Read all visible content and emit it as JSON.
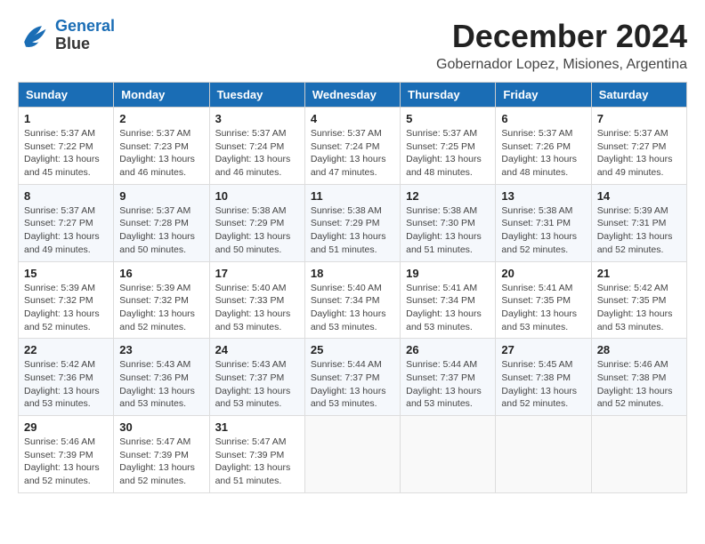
{
  "logo": {
    "line1": "General",
    "line2": "Blue"
  },
  "title": "December 2024",
  "subtitle": "Gobernador Lopez, Misiones, Argentina",
  "days_of_week": [
    "Sunday",
    "Monday",
    "Tuesday",
    "Wednesday",
    "Thursday",
    "Friday",
    "Saturday"
  ],
  "weeks": [
    [
      {
        "day": "1",
        "info": "Sunrise: 5:37 AM\nSunset: 7:22 PM\nDaylight: 13 hours\nand 45 minutes."
      },
      {
        "day": "2",
        "info": "Sunrise: 5:37 AM\nSunset: 7:23 PM\nDaylight: 13 hours\nand 46 minutes."
      },
      {
        "day": "3",
        "info": "Sunrise: 5:37 AM\nSunset: 7:24 PM\nDaylight: 13 hours\nand 46 minutes."
      },
      {
        "day": "4",
        "info": "Sunrise: 5:37 AM\nSunset: 7:24 PM\nDaylight: 13 hours\nand 47 minutes."
      },
      {
        "day": "5",
        "info": "Sunrise: 5:37 AM\nSunset: 7:25 PM\nDaylight: 13 hours\nand 48 minutes."
      },
      {
        "day": "6",
        "info": "Sunrise: 5:37 AM\nSunset: 7:26 PM\nDaylight: 13 hours\nand 48 minutes."
      },
      {
        "day": "7",
        "info": "Sunrise: 5:37 AM\nSunset: 7:27 PM\nDaylight: 13 hours\nand 49 minutes."
      }
    ],
    [
      {
        "day": "8",
        "info": "Sunrise: 5:37 AM\nSunset: 7:27 PM\nDaylight: 13 hours\nand 49 minutes."
      },
      {
        "day": "9",
        "info": "Sunrise: 5:37 AM\nSunset: 7:28 PM\nDaylight: 13 hours\nand 50 minutes."
      },
      {
        "day": "10",
        "info": "Sunrise: 5:38 AM\nSunset: 7:29 PM\nDaylight: 13 hours\nand 50 minutes."
      },
      {
        "day": "11",
        "info": "Sunrise: 5:38 AM\nSunset: 7:29 PM\nDaylight: 13 hours\nand 51 minutes."
      },
      {
        "day": "12",
        "info": "Sunrise: 5:38 AM\nSunset: 7:30 PM\nDaylight: 13 hours\nand 51 minutes."
      },
      {
        "day": "13",
        "info": "Sunrise: 5:38 AM\nSunset: 7:31 PM\nDaylight: 13 hours\nand 52 minutes."
      },
      {
        "day": "14",
        "info": "Sunrise: 5:39 AM\nSunset: 7:31 PM\nDaylight: 13 hours\nand 52 minutes."
      }
    ],
    [
      {
        "day": "15",
        "info": "Sunrise: 5:39 AM\nSunset: 7:32 PM\nDaylight: 13 hours\nand 52 minutes."
      },
      {
        "day": "16",
        "info": "Sunrise: 5:39 AM\nSunset: 7:32 PM\nDaylight: 13 hours\nand 52 minutes."
      },
      {
        "day": "17",
        "info": "Sunrise: 5:40 AM\nSunset: 7:33 PM\nDaylight: 13 hours\nand 53 minutes."
      },
      {
        "day": "18",
        "info": "Sunrise: 5:40 AM\nSunset: 7:34 PM\nDaylight: 13 hours\nand 53 minutes."
      },
      {
        "day": "19",
        "info": "Sunrise: 5:41 AM\nSunset: 7:34 PM\nDaylight: 13 hours\nand 53 minutes."
      },
      {
        "day": "20",
        "info": "Sunrise: 5:41 AM\nSunset: 7:35 PM\nDaylight: 13 hours\nand 53 minutes."
      },
      {
        "day": "21",
        "info": "Sunrise: 5:42 AM\nSunset: 7:35 PM\nDaylight: 13 hours\nand 53 minutes."
      }
    ],
    [
      {
        "day": "22",
        "info": "Sunrise: 5:42 AM\nSunset: 7:36 PM\nDaylight: 13 hours\nand 53 minutes."
      },
      {
        "day": "23",
        "info": "Sunrise: 5:43 AM\nSunset: 7:36 PM\nDaylight: 13 hours\nand 53 minutes."
      },
      {
        "day": "24",
        "info": "Sunrise: 5:43 AM\nSunset: 7:37 PM\nDaylight: 13 hours\nand 53 minutes."
      },
      {
        "day": "25",
        "info": "Sunrise: 5:44 AM\nSunset: 7:37 PM\nDaylight: 13 hours\nand 53 minutes."
      },
      {
        "day": "26",
        "info": "Sunrise: 5:44 AM\nSunset: 7:37 PM\nDaylight: 13 hours\nand 53 minutes."
      },
      {
        "day": "27",
        "info": "Sunrise: 5:45 AM\nSunset: 7:38 PM\nDaylight: 13 hours\nand 52 minutes."
      },
      {
        "day": "28",
        "info": "Sunrise: 5:46 AM\nSunset: 7:38 PM\nDaylight: 13 hours\nand 52 minutes."
      }
    ],
    [
      {
        "day": "29",
        "info": "Sunrise: 5:46 AM\nSunset: 7:39 PM\nDaylight: 13 hours\nand 52 minutes."
      },
      {
        "day": "30",
        "info": "Sunrise: 5:47 AM\nSunset: 7:39 PM\nDaylight: 13 hours\nand 52 minutes."
      },
      {
        "day": "31",
        "info": "Sunrise: 5:47 AM\nSunset: 7:39 PM\nDaylight: 13 hours\nand 51 minutes."
      },
      {
        "day": "",
        "info": ""
      },
      {
        "day": "",
        "info": ""
      },
      {
        "day": "",
        "info": ""
      },
      {
        "day": "",
        "info": ""
      }
    ]
  ]
}
